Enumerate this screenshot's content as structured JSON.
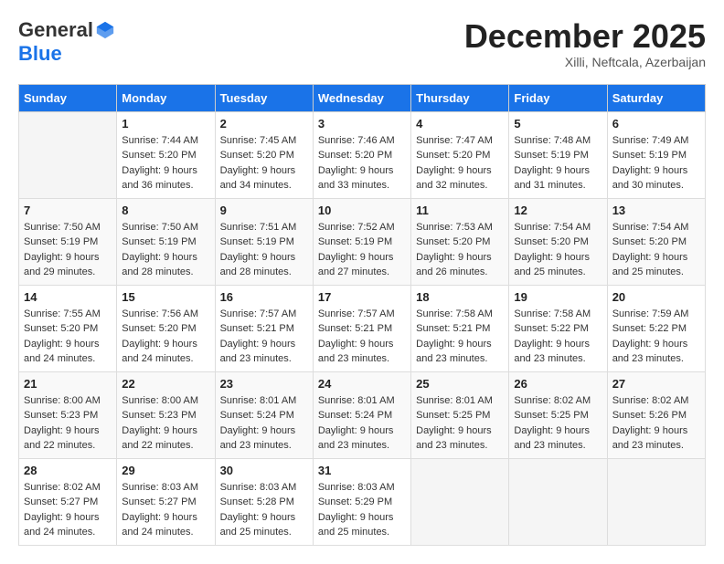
{
  "header": {
    "logo_general": "General",
    "logo_blue": "Blue",
    "month_title": "December 2025",
    "location": "Xilli, Neftcala, Azerbaijan"
  },
  "calendar": {
    "days_of_week": [
      "Sunday",
      "Monday",
      "Tuesday",
      "Wednesday",
      "Thursday",
      "Friday",
      "Saturday"
    ],
    "weeks": [
      [
        {
          "day": "",
          "sunrise": "",
          "sunset": "",
          "daylight": ""
        },
        {
          "day": "1",
          "sunrise": "Sunrise: 7:44 AM",
          "sunset": "Sunset: 5:20 PM",
          "daylight": "Daylight: 9 hours and 36 minutes."
        },
        {
          "day": "2",
          "sunrise": "Sunrise: 7:45 AM",
          "sunset": "Sunset: 5:20 PM",
          "daylight": "Daylight: 9 hours and 34 minutes."
        },
        {
          "day": "3",
          "sunrise": "Sunrise: 7:46 AM",
          "sunset": "Sunset: 5:20 PM",
          "daylight": "Daylight: 9 hours and 33 minutes."
        },
        {
          "day": "4",
          "sunrise": "Sunrise: 7:47 AM",
          "sunset": "Sunset: 5:20 PM",
          "daylight": "Daylight: 9 hours and 32 minutes."
        },
        {
          "day": "5",
          "sunrise": "Sunrise: 7:48 AM",
          "sunset": "Sunset: 5:19 PM",
          "daylight": "Daylight: 9 hours and 31 minutes."
        },
        {
          "day": "6",
          "sunrise": "Sunrise: 7:49 AM",
          "sunset": "Sunset: 5:19 PM",
          "daylight": "Daylight: 9 hours and 30 minutes."
        }
      ],
      [
        {
          "day": "7",
          "sunrise": "Sunrise: 7:50 AM",
          "sunset": "Sunset: 5:19 PM",
          "daylight": "Daylight: 9 hours and 29 minutes."
        },
        {
          "day": "8",
          "sunrise": "Sunrise: 7:50 AM",
          "sunset": "Sunset: 5:19 PM",
          "daylight": "Daylight: 9 hours and 28 minutes."
        },
        {
          "day": "9",
          "sunrise": "Sunrise: 7:51 AM",
          "sunset": "Sunset: 5:19 PM",
          "daylight": "Daylight: 9 hours and 28 minutes."
        },
        {
          "day": "10",
          "sunrise": "Sunrise: 7:52 AM",
          "sunset": "Sunset: 5:19 PM",
          "daylight": "Daylight: 9 hours and 27 minutes."
        },
        {
          "day": "11",
          "sunrise": "Sunrise: 7:53 AM",
          "sunset": "Sunset: 5:20 PM",
          "daylight": "Daylight: 9 hours and 26 minutes."
        },
        {
          "day": "12",
          "sunrise": "Sunrise: 7:54 AM",
          "sunset": "Sunset: 5:20 PM",
          "daylight": "Daylight: 9 hours and 25 minutes."
        },
        {
          "day": "13",
          "sunrise": "Sunrise: 7:54 AM",
          "sunset": "Sunset: 5:20 PM",
          "daylight": "Daylight: 9 hours and 25 minutes."
        }
      ],
      [
        {
          "day": "14",
          "sunrise": "Sunrise: 7:55 AM",
          "sunset": "Sunset: 5:20 PM",
          "daylight": "Daylight: 9 hours and 24 minutes."
        },
        {
          "day": "15",
          "sunrise": "Sunrise: 7:56 AM",
          "sunset": "Sunset: 5:20 PM",
          "daylight": "Daylight: 9 hours and 24 minutes."
        },
        {
          "day": "16",
          "sunrise": "Sunrise: 7:57 AM",
          "sunset": "Sunset: 5:21 PM",
          "daylight": "Daylight: 9 hours and 23 minutes."
        },
        {
          "day": "17",
          "sunrise": "Sunrise: 7:57 AM",
          "sunset": "Sunset: 5:21 PM",
          "daylight": "Daylight: 9 hours and 23 minutes."
        },
        {
          "day": "18",
          "sunrise": "Sunrise: 7:58 AM",
          "sunset": "Sunset: 5:21 PM",
          "daylight": "Daylight: 9 hours and 23 minutes."
        },
        {
          "day": "19",
          "sunrise": "Sunrise: 7:58 AM",
          "sunset": "Sunset: 5:22 PM",
          "daylight": "Daylight: 9 hours and 23 minutes."
        },
        {
          "day": "20",
          "sunrise": "Sunrise: 7:59 AM",
          "sunset": "Sunset: 5:22 PM",
          "daylight": "Daylight: 9 hours and 23 minutes."
        }
      ],
      [
        {
          "day": "21",
          "sunrise": "Sunrise: 8:00 AM",
          "sunset": "Sunset: 5:23 PM",
          "daylight": "Daylight: 9 hours and 22 minutes."
        },
        {
          "day": "22",
          "sunrise": "Sunrise: 8:00 AM",
          "sunset": "Sunset: 5:23 PM",
          "daylight": "Daylight: 9 hours and 22 minutes."
        },
        {
          "day": "23",
          "sunrise": "Sunrise: 8:01 AM",
          "sunset": "Sunset: 5:24 PM",
          "daylight": "Daylight: 9 hours and 23 minutes."
        },
        {
          "day": "24",
          "sunrise": "Sunrise: 8:01 AM",
          "sunset": "Sunset: 5:24 PM",
          "daylight": "Daylight: 9 hours and 23 minutes."
        },
        {
          "day": "25",
          "sunrise": "Sunrise: 8:01 AM",
          "sunset": "Sunset: 5:25 PM",
          "daylight": "Daylight: 9 hours and 23 minutes."
        },
        {
          "day": "26",
          "sunrise": "Sunrise: 8:02 AM",
          "sunset": "Sunset: 5:25 PM",
          "daylight": "Daylight: 9 hours and 23 minutes."
        },
        {
          "day": "27",
          "sunrise": "Sunrise: 8:02 AM",
          "sunset": "Sunset: 5:26 PM",
          "daylight": "Daylight: 9 hours and 23 minutes."
        }
      ],
      [
        {
          "day": "28",
          "sunrise": "Sunrise: 8:02 AM",
          "sunset": "Sunset: 5:27 PM",
          "daylight": "Daylight: 9 hours and 24 minutes."
        },
        {
          "day": "29",
          "sunrise": "Sunrise: 8:03 AM",
          "sunset": "Sunset: 5:27 PM",
          "daylight": "Daylight: 9 hours and 24 minutes."
        },
        {
          "day": "30",
          "sunrise": "Sunrise: 8:03 AM",
          "sunset": "Sunset: 5:28 PM",
          "daylight": "Daylight: 9 hours and 25 minutes."
        },
        {
          "day": "31",
          "sunrise": "Sunrise: 8:03 AM",
          "sunset": "Sunset: 5:29 PM",
          "daylight": "Daylight: 9 hours and 25 minutes."
        },
        {
          "day": "",
          "sunrise": "",
          "sunset": "",
          "daylight": ""
        },
        {
          "day": "",
          "sunrise": "",
          "sunset": "",
          "daylight": ""
        },
        {
          "day": "",
          "sunrise": "",
          "sunset": "",
          "daylight": ""
        }
      ]
    ]
  }
}
